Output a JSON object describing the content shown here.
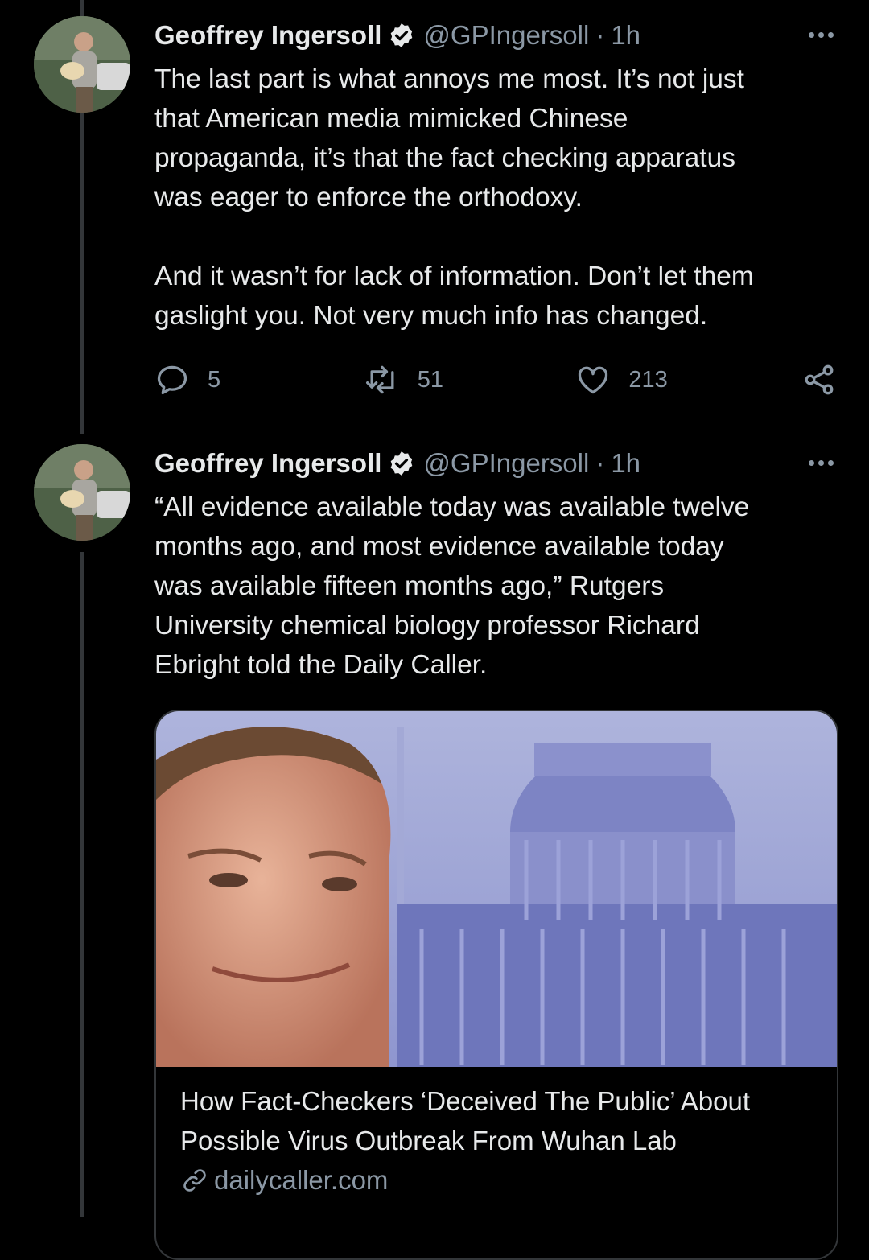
{
  "tweets": [
    {
      "author": {
        "name": "Geoffrey Ingersoll",
        "handle": "@GPIngersoll",
        "time": "1h",
        "verified": true
      },
      "text": "The last part is what annoys me most. It’s not just\nthat American media mimicked Chinese\npropaganda, it’s that the fact checking apparatus\nwas eager to enforce the orthodoxy.\n\nAnd it wasn’t for lack of information. Don’t let them\ngaslight you. Not very much info has changed.",
      "actions": {
        "replies": "5",
        "retweets": "51",
        "likes": "213"
      }
    },
    {
      "author": {
        "name": "Geoffrey Ingersoll",
        "handle": "@GPIngersoll",
        "time": "1h",
        "verified": true
      },
      "text": "“All evidence available today was available twelve\nmonths ago, and most evidence available today\nwas available fifteen months ago,” Rutgers\nUniversity chemical biology professor Richard\nEbright told the Daily Caller.",
      "card": {
        "title_line1": "How Fact-Checkers ‘Deceived The Public’ About",
        "title_line2": "Possible Virus Outbreak From Wuhan Lab",
        "domain": "dailycaller.com"
      }
    }
  ],
  "separator": "·",
  "colors": {
    "background": "#000000",
    "text": "#e7e9ea",
    "secondary": "#8b98a5",
    "border": "#333639"
  }
}
